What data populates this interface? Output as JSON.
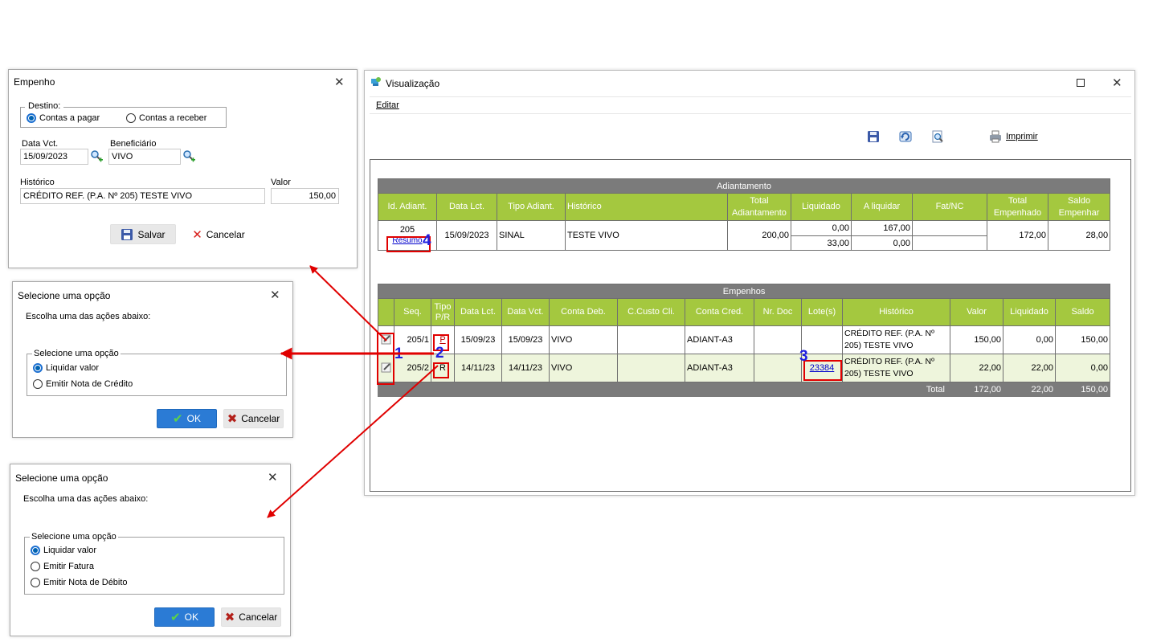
{
  "empenho_dialog": {
    "title": "Empenho",
    "destino_label": "Destino:",
    "destino_options": [
      "Contas a pagar",
      "Contas a receber"
    ],
    "data_vct_label": "Data Vct.",
    "data_vct_value": "15/09/2023",
    "beneficiario_label": "Beneficiário",
    "beneficiario_value": "VIVO",
    "historico_label": "Histórico",
    "historico_value": "CRÉDITO REF. (P.A. Nº 205) TESTE VIVO",
    "valor_label": "Valor",
    "valor_value": "150,00",
    "save_label": "Salvar",
    "cancel_label": "Cancelar"
  },
  "option_dialog_1": {
    "title": "Selecione uma opção",
    "prompt": "Escolha uma das ações abaixo:",
    "group_label": "Selecione uma opção",
    "options": [
      "Liquidar valor",
      "Emitir Nota de Crédito"
    ],
    "ok_label": "OK",
    "cancel_label": "Cancelar"
  },
  "option_dialog_2": {
    "title": "Selecione uma opção",
    "prompt": "Escolha uma das ações abaixo:",
    "group_label": "Selecione uma opção",
    "options": [
      "Liquidar valor",
      "Emitir Fatura",
      "Emitir Nota de Débito"
    ],
    "ok_label": "OK",
    "cancel_label": "Cancelar"
  },
  "viz_window": {
    "title": "Visualização",
    "menu_edit": "Editar",
    "print_label": "Imprimir"
  },
  "adiantamento": {
    "caption": "Adiantamento",
    "headers": [
      "Id. Adiant.",
      "Data Lct.",
      "Tipo Adiant.",
      "Histórico",
      "Total Adiantamento",
      "Liquidado",
      "A liquidar",
      "Fat/NC",
      "Total Empenhado",
      "Saldo Empenhar"
    ],
    "id": "205",
    "resumo_link": "Resumo",
    "data_lct": "15/09/2023",
    "tipo": "SINAL",
    "historico": "TESTE VIVO",
    "total_adiant": "200,00",
    "liquidado": [
      "0,00",
      "33,00"
    ],
    "a_liquidar": [
      "167,00",
      "0,00"
    ],
    "fat_nc": [
      "",
      ""
    ],
    "total_empenhado": "172,00",
    "saldo_empenhar": "28,00"
  },
  "empenhos": {
    "caption": "Empenhos",
    "headers": [
      "",
      "Seq.",
      "Tipo P/R",
      "Data Lct.",
      "Data Vct.",
      "Conta Deb.",
      "C.Custo Cli.",
      "Conta Cred.",
      "Nr. Doc",
      "Lote(s)",
      "Histórico",
      "Valor",
      "Liquidado",
      "Saldo"
    ],
    "rows": [
      {
        "seq": "205/1",
        "tipo": "P",
        "data_lct": "15/09/23",
        "data_vct": "15/09/23",
        "conta_deb": "VIVO",
        "ccusto": "",
        "conta_cred": "ADIANT-A3",
        "nr_doc": "",
        "lote": "",
        "historico": "CRÉDITO REF. (P.A. Nº 205) TESTE VIVO",
        "valor": "150,00",
        "liquidado": "0,00",
        "saldo": "150,00"
      },
      {
        "seq": "205/2",
        "tipo": "R",
        "data_lct": "14/11/23",
        "data_vct": "14/11/23",
        "conta_deb": "VIVO",
        "ccusto": "",
        "conta_cred": "ADIANT-A3",
        "nr_doc": "",
        "lote": "23384",
        "historico": "CRÉDITO REF. (P.A. Nº 205) TESTE VIVO",
        "valor": "22,00",
        "liquidado": "22,00",
        "saldo": "0,00"
      }
    ],
    "total_label": "Total",
    "total_valor": "172,00",
    "total_liquidado": "22,00",
    "total_saldo": "150,00"
  },
  "annotations": {
    "n1": "1",
    "n2": "2",
    "n3": "3",
    "n4": "4"
  },
  "colors": {
    "header_green": "#a4c83f",
    "caption_gray": "#7b7b7b",
    "annotation_red": "#e00000",
    "annotation_blue": "#1f1fe0",
    "ok_blue": "#2b7bd5"
  }
}
